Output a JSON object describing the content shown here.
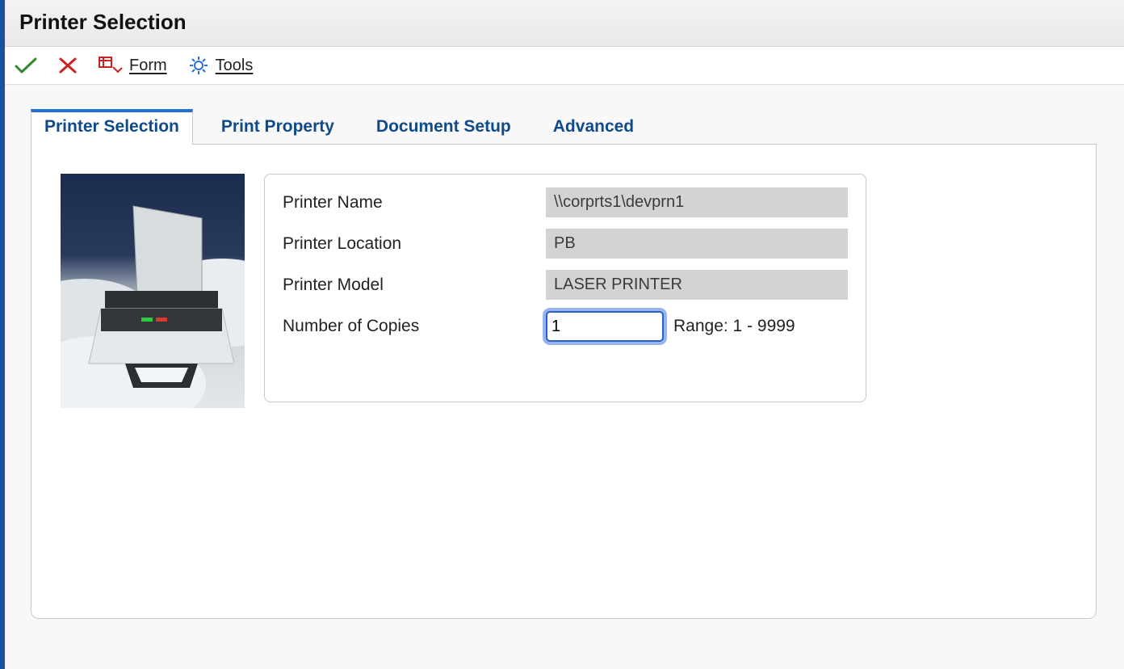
{
  "window": {
    "title": "Printer Selection"
  },
  "toolbar": {
    "form_label": "Form",
    "tools_label": "Tools"
  },
  "tabs": [
    {
      "label": "Printer Selection",
      "active": true
    },
    {
      "label": "Print Property",
      "active": false
    },
    {
      "label": "Document Setup",
      "active": false
    },
    {
      "label": "Advanced",
      "active": false
    }
  ],
  "fields": {
    "printer_name": {
      "label": "Printer Name",
      "value": "\\\\corprts1\\devprn1"
    },
    "printer_location": {
      "label": "Printer Location",
      "value": "PB"
    },
    "printer_model": {
      "label": "Printer Model",
      "value": "LASER PRINTER"
    },
    "copies": {
      "label": "Number of Copies",
      "value": "1",
      "range_text": "Range: 1 - 9999"
    }
  },
  "colors": {
    "accent": "#1f6fd4",
    "tab_text": "#0f4b8a",
    "readonly_bg": "#d3d3d3"
  }
}
